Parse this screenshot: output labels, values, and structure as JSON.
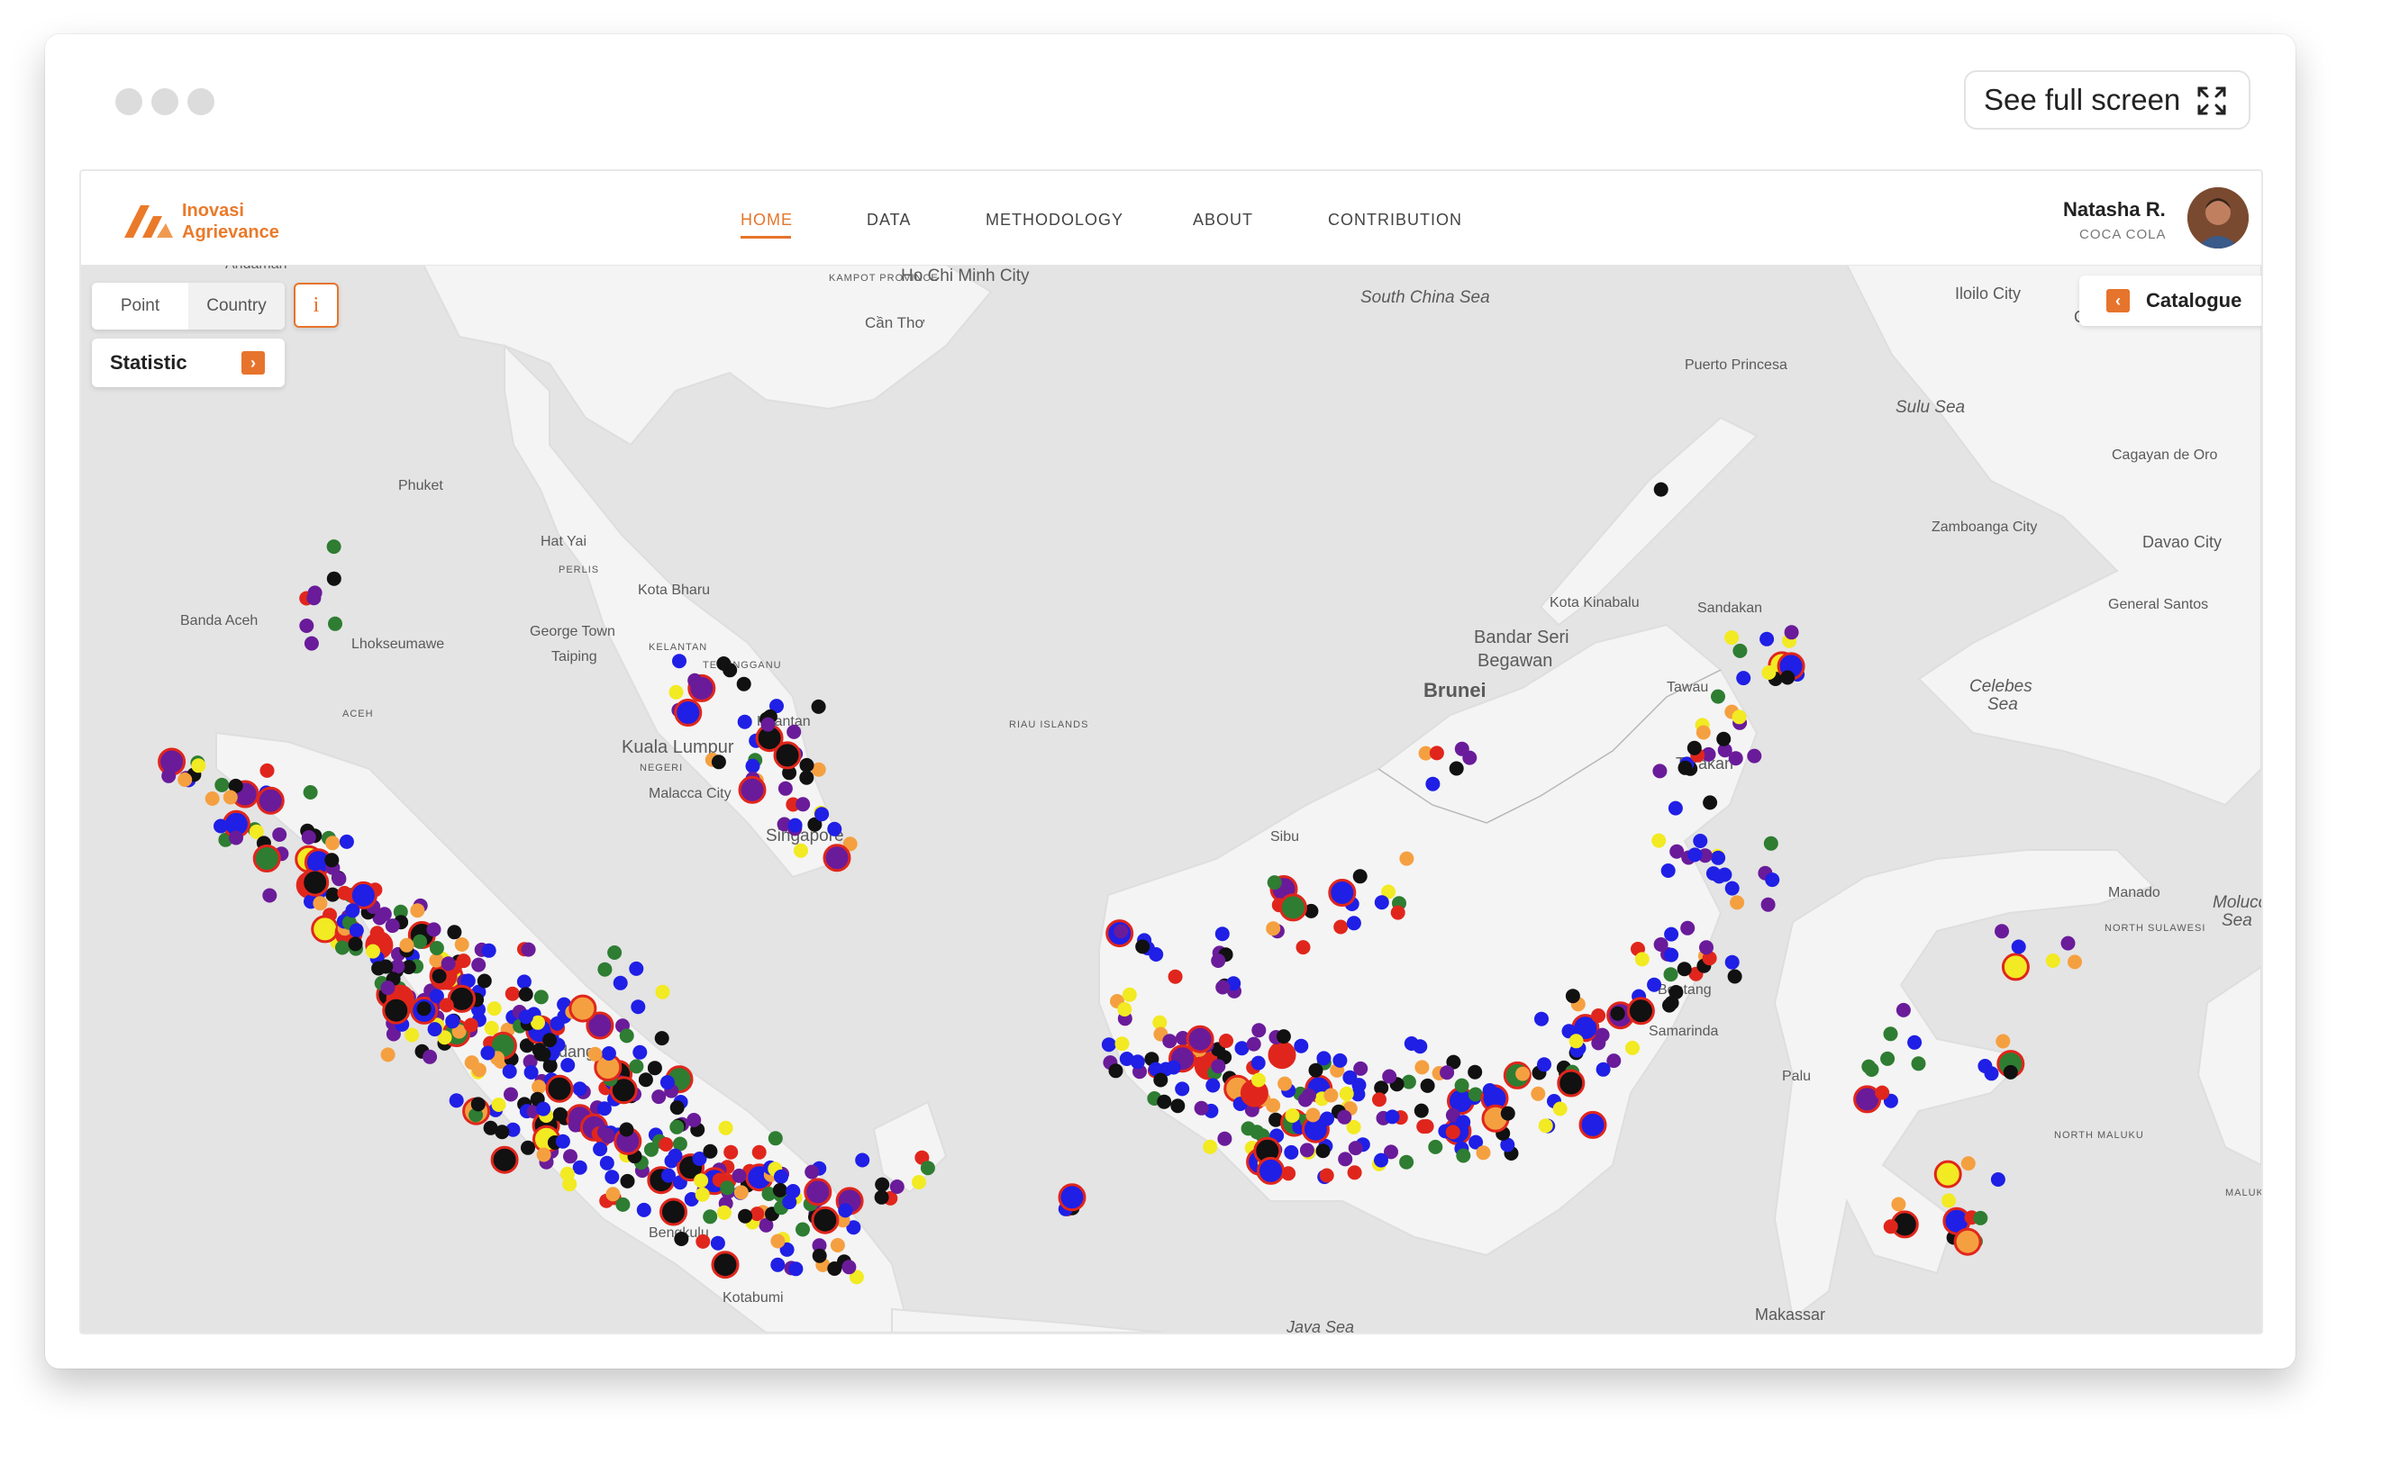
{
  "window": {
    "fullscreen_label": "See full screen"
  },
  "brand": {
    "line1": "Inovasi",
    "line2": "Agrievance",
    "color": "#ea7a2a"
  },
  "nav": {
    "items": [
      "HOME",
      "DATA",
      "METHODOLOGY",
      "ABOUT",
      "CONTRIBUTION"
    ],
    "active": "HOME"
  },
  "user": {
    "name": "Natasha R.",
    "company": "COCA COLA"
  },
  "controls": {
    "toggle": [
      "Point",
      "Country"
    ],
    "toggle_selected": "Point",
    "info": "i",
    "statistic": "Statistic",
    "catalogue": "Catalogue"
  },
  "map": {
    "place_labels": [
      "Andaman",
      "Ho Chi Minh City",
      "KAMPOT PROVINCE",
      "Cần Thơ",
      "South China Sea",
      "Iloilo City",
      "Ce",
      "Puerto Princesa",
      "Sulu Sea",
      "Cagayan de Oro",
      "Phuket",
      "Hat Yai",
      "PERLIS",
      "Kota Bharu",
      "Banda Aceh",
      "Lhokseumawe",
      "George Town",
      "KELANTAN",
      "TERENGGANU",
      "Taiping",
      "ACEH",
      "Kuantan",
      "Kuala Lumpur",
      "NEGERI",
      "Malacca City",
      "RIAU ISLANDS",
      "Singapore",
      "Zamboanga City",
      "Davao City",
      "General Santos",
      "Kota Kinabalu",
      "Sandakan",
      "Bandar Seri",
      "Begawan",
      "Brunei",
      "Tawau",
      "Celebes",
      "Sea",
      "Tarakan",
      "Sibu",
      "Manado",
      "Molucca",
      "Sea",
      "NORTH SULAWESI",
      "Bontang",
      "Samarinda",
      "Padang",
      "Palu",
      "NORTH MALUKU",
      "MALUK",
      "Bengkulu",
      "Kotabumi",
      "Makassar",
      "Java Sea"
    ],
    "marker_colors": {
      "purple": "#6a1b9a",
      "blue": "#1f1fe6",
      "black": "#111111",
      "red": "#e0261c",
      "green": "#2e7d32",
      "yellow": "#f2ea22",
      "orange": "#f5a040"
    }
  }
}
